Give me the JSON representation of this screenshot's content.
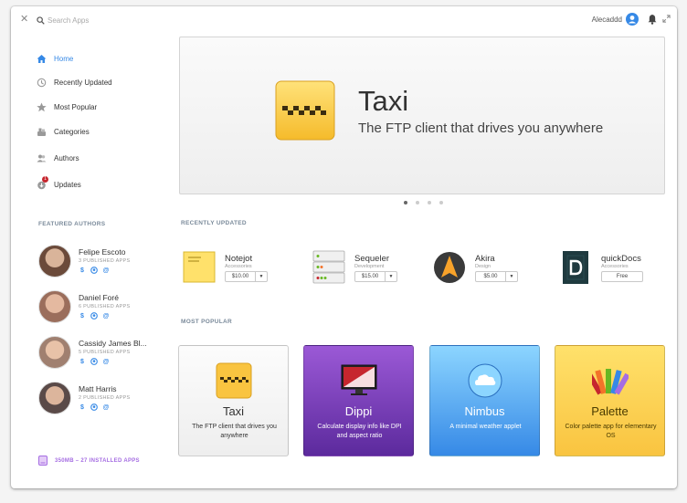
{
  "header": {
    "search_placeholder": "Search Apps",
    "user_name": "Alecaddd"
  },
  "sidebar": {
    "nav": [
      {
        "label": "Home",
        "icon": "home-icon",
        "active": true
      },
      {
        "label": "Recently Updated",
        "icon": "history-icon"
      },
      {
        "label": "Most Popular",
        "icon": "star-icon"
      },
      {
        "label": "Categories",
        "icon": "categories-icon"
      },
      {
        "label": "Authors",
        "icon": "authors-icon"
      },
      {
        "label": "Updates",
        "icon": "updates-icon",
        "badge": "1"
      }
    ],
    "featured_label": "FEATURED AUTHORS",
    "authors": [
      {
        "name": "Felipe Escoto",
        "apps": "3 PUBLISHED APPS"
      },
      {
        "name": "Daniel Foré",
        "apps": "6 PUBLISHED APPS"
      },
      {
        "name": "Cassidy James Bl...",
        "apps": "5 PUBLISHED APPS"
      },
      {
        "name": "Matt Harris",
        "apps": "2 PUBLISHED APPS"
      }
    ],
    "author_link_icons": [
      "dollar-icon",
      "github-icon",
      "mastodon-icon"
    ],
    "storage": "350MB – 27 INSTALLED APPS"
  },
  "banner": {
    "title": "Taxi",
    "subtitle": "The FTP client that drives you anywhere",
    "slides": 4,
    "active_slide": 0
  },
  "recently_updated": {
    "label": "RECENTLY UPDATED",
    "items": [
      {
        "name": "Notejot",
        "category": "Accessories",
        "price": "$10.00"
      },
      {
        "name": "Sequeler",
        "category": "Development",
        "price": "$15.00"
      },
      {
        "name": "Akira",
        "category": "Design",
        "price": "$5.00"
      },
      {
        "name": "quickDocs",
        "category": "Accessories",
        "price": "Free"
      }
    ]
  },
  "most_popular": {
    "label": "MOST POPULAR",
    "items": [
      {
        "name": "Taxi",
        "description": "The FTP client that drives you anywhere"
      },
      {
        "name": "Dippi",
        "description": "Calculate display info like DPI and aspect ratio"
      },
      {
        "name": "Nimbus",
        "description": "A minimal weather applet"
      },
      {
        "name": "Palette",
        "description": "Color palette app for elementary OS"
      }
    ]
  },
  "colors": {
    "accent": "#3689e6",
    "storage": "#a56de2",
    "taxi_yellow": "#f9c440",
    "dippi_purple": "#7a36b1",
    "nimbus_blue": "#3689e6",
    "palette_yellow": "#ffe16b"
  }
}
